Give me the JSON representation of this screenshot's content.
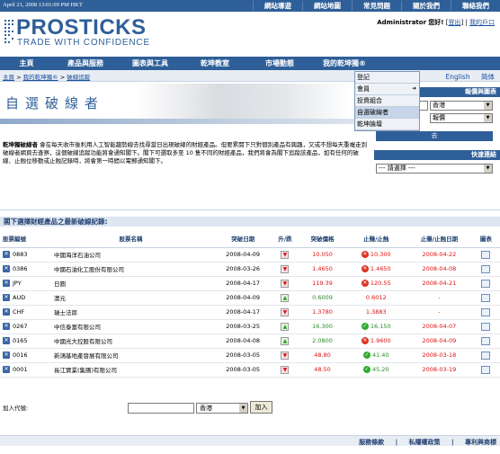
{
  "topbar": {
    "datetime": "April 21, 2008 13:01:09 PM HKT",
    "links": [
      "網站導遊",
      "網站地圖",
      "常見問題",
      "關於我們",
      "聯絡我們"
    ]
  },
  "brand": {
    "name": "PROSTICKS",
    "tagline": "TRADE WITH CONFIDENCE"
  },
  "user": {
    "name": "Administrator",
    "greeting": "您好!",
    "logout": "登出",
    "portal": "我的戶口",
    "sep": "|"
  },
  "nav": [
    "主頁",
    "產品與服務",
    "圖表與工具",
    "乾坤教室",
    "市場動態",
    "我的乾坤獨®"
  ],
  "breadcrumb": {
    "home": "主頁",
    "sep": ">",
    "item1": "我的乾坤獨®",
    "item2": "破線追蹤"
  },
  "lang": [
    "English",
    "简体"
  ],
  "dropdown": {
    "items": [
      "登記",
      "會員",
      "投資組合",
      "自選破線者",
      "乾坤論壇"
    ],
    "selected": 3,
    "arrow_index": 1
  },
  "page_title": "自選破線者",
  "quote_panel": {
    "title": "報價與圖表",
    "market": "香港",
    "type": "報價",
    "button": "去"
  },
  "quick_panel": {
    "title": "快速連結",
    "select": "--- 請選擇 ---"
  },
  "description": {
    "lead": "乾坤獨破線者",
    "text": "會在每天收市後利用人工智能趨勢線去找尋當日出現破線的財經產品。但要累閱下只對個別產品有興趣，又或不想每天重複走到破線者網頁去查察，這個破線追蹤功能將會通知閣下。閣下可選取多至 10 隻不同的財經產品，我們將會為閣下追蹤該產品，如有任何的破線、止蝕位移動或止蝕記錄時，將會第一時間以電郵通知閣下。"
  },
  "section_title": "閣下選擇財經產品之最新破線記錄:",
  "table": {
    "headers": [
      "股票編號",
      "股票名稱",
      "突破日期",
      "升/跌",
      "突破價格",
      "止賺/止蝕",
      "止賺/止蝕日期",
      "圖表"
    ],
    "rows": [
      {
        "code": "0883",
        "name": "中國海洋石油公司",
        "date": "2008-04-09",
        "dir": "down",
        "price": "10.050",
        "stop": "10.300",
        "stop_type": "r",
        "stop_date": "2008-04-22"
      },
      {
        "code": "0386",
        "name": "中國石油化工股份有限公司",
        "date": "2008-03-26",
        "dir": "down",
        "price": "1.4650",
        "stop": "1.4650",
        "stop_type": "r",
        "stop_date": "2008-04-08"
      },
      {
        "code": "JPY",
        "name": "日圓",
        "date": "2008-04-17",
        "dir": "down",
        "price": "119.39",
        "stop": "120.55",
        "stop_type": "r",
        "stop_date": "2008-04-21"
      },
      {
        "code": "AUD",
        "name": "澳元",
        "date": "2008-04-09",
        "dir": "up",
        "price": "0.6009",
        "stop": "0.6012",
        "stop_type": "",
        "stop_date": "-"
      },
      {
        "code": "CHF",
        "name": "瑞士法郎",
        "date": "2008-04-17",
        "dir": "down",
        "price": "1.3780",
        "stop": "1.3883",
        "stop_type": "",
        "stop_date": "-"
      },
      {
        "code": "0267",
        "name": "中信泰富有限公司",
        "date": "2008-03-25",
        "dir": "up",
        "price": "16.300",
        "stop": "16.150",
        "stop_type": "g",
        "stop_date": "2008-04-07"
      },
      {
        "code": "0165",
        "name": "中國光大控股有限公司",
        "date": "2008-04-08",
        "dir": "up",
        "price": "2.0800",
        "stop": "1.9600",
        "stop_type": "r",
        "stop_date": "2008-04-09"
      },
      {
        "code": "0016",
        "name": "新鴻基地產發展有限公司",
        "date": "2008-03-05",
        "dir": "down",
        "price": "48.80",
        "stop": "41.40",
        "stop_type": "g",
        "stop_date": "2008-03-18"
      },
      {
        "code": "0001",
        "name": "長江實業(集團)有限公司",
        "date": "2008-03-05",
        "dir": "down",
        "price": "48.50",
        "stop": "45.20",
        "stop_type": "g",
        "stop_date": "2008-03-19"
      }
    ]
  },
  "add": {
    "label": "加入代號:",
    "market": "香港",
    "button": "加入"
  },
  "footer": {
    "links": [
      "服務條款",
      "私隱權政策",
      "專利與商標"
    ],
    "sep": "|"
  },
  "colors": {
    "brand_blue": "#2f5f98",
    "up_green": "#2a8a2a",
    "down_red": "#d11"
  }
}
